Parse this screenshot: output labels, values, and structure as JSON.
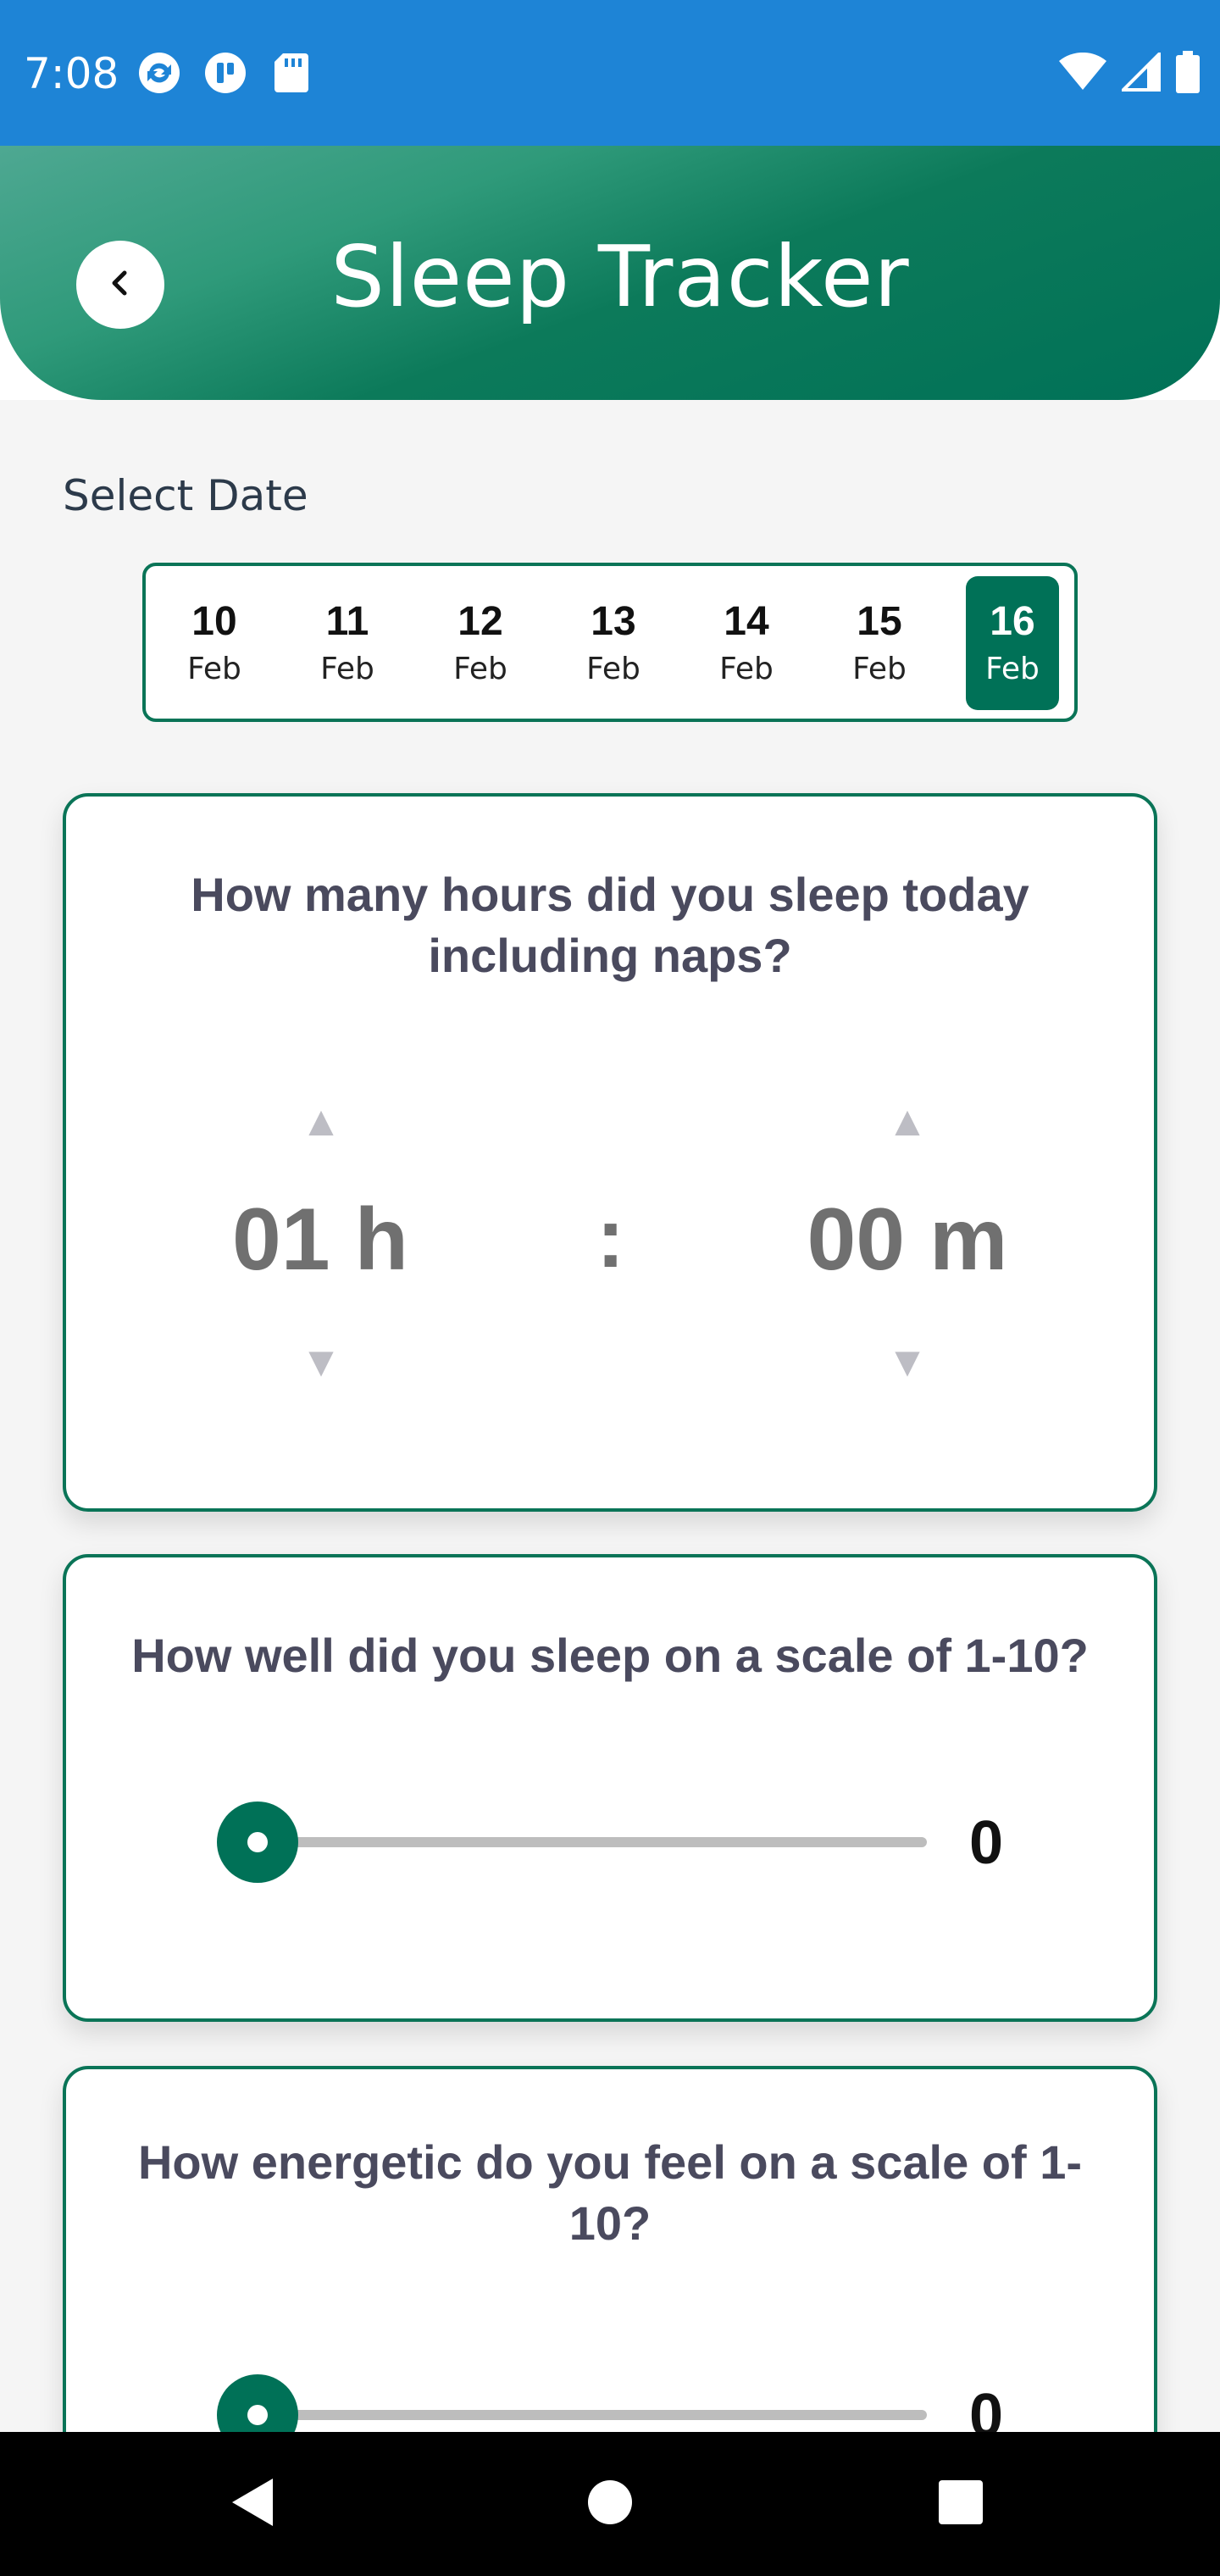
{
  "status_bar": {
    "time": "7:08",
    "left_icons": [
      "sync-icon",
      "app-icon",
      "sd-card-icon"
    ],
    "right_icons": [
      "wifi-icon",
      "signal-icon",
      "battery-icon"
    ]
  },
  "header": {
    "title": "Sleep Tracker",
    "back_icon": "chevron-left-icon"
  },
  "date_selector": {
    "label": "Select Date",
    "dates": [
      {
        "day": "10",
        "month": "Feb"
      },
      {
        "day": "11",
        "month": "Feb"
      },
      {
        "day": "12",
        "month": "Feb"
      },
      {
        "day": "13",
        "month": "Feb"
      },
      {
        "day": "14",
        "month": "Feb"
      },
      {
        "day": "15",
        "month": "Feb"
      },
      {
        "day": "16",
        "month": "Feb"
      }
    ],
    "selected_index": 6
  },
  "sleep_hours_card": {
    "question": "How many hours did you sleep today including naps?",
    "hours": "01 h",
    "separator": ":",
    "minutes": "00 m"
  },
  "sleep_quality_card": {
    "question": "How well did you sleep on a scale of 1-10?",
    "value": "0",
    "fraction": 0
  },
  "energy_card": {
    "question": "How energetic do you feel on a scale of 1-10?",
    "value": "0",
    "fraction": 0
  },
  "nav_bar": {
    "icons": [
      "back-triangle-icon",
      "home-circle-icon",
      "recents-square-icon"
    ]
  },
  "colors": {
    "status_bar": "#1e84d6",
    "primary": "#007157",
    "card_border": "#0a7457",
    "question_text": "#4a4a5e"
  }
}
